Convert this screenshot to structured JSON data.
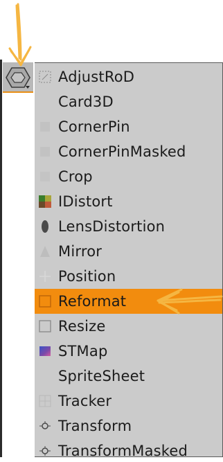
{
  "menu": {
    "items": [
      {
        "label": "AdjustRoD",
        "icon": "adjust-rod-icon",
        "selected": false
      },
      {
        "label": "Card3D",
        "icon": "card3d-icon",
        "selected": false
      },
      {
        "label": "CornerPin",
        "icon": "cornerpin-icon",
        "selected": false
      },
      {
        "label": "CornerPinMasked",
        "icon": "cornerpin-masked-icon",
        "selected": false
      },
      {
        "label": "Crop",
        "icon": "crop-icon",
        "selected": false
      },
      {
        "label": "IDistort",
        "icon": "idistort-icon",
        "selected": false
      },
      {
        "label": "LensDistortion",
        "icon": "lens-distortion-icon",
        "selected": false
      },
      {
        "label": "Mirror",
        "icon": "mirror-icon",
        "selected": false
      },
      {
        "label": "Position",
        "icon": "position-icon",
        "selected": false
      },
      {
        "label": "Reformat",
        "icon": "reformat-icon",
        "selected": true
      },
      {
        "label": "Resize",
        "icon": "resize-icon",
        "selected": false
      },
      {
        "label": "STMap",
        "icon": "stmap-icon",
        "selected": false
      },
      {
        "label": "SpriteSheet",
        "icon": "",
        "selected": false
      },
      {
        "label": "Tracker",
        "icon": "tracker-icon",
        "selected": false
      },
      {
        "label": "Transform",
        "icon": "transform-icon",
        "selected": false
      },
      {
        "label": "TransformMasked",
        "icon": "transform-masked-icon",
        "selected": false
      }
    ]
  },
  "toolbar": {
    "icon": "transform-hexagon-icon"
  },
  "colors": {
    "selected": "#f28c0e",
    "menu_bg": "#cbcbcb",
    "annotation": "#f5b642"
  }
}
